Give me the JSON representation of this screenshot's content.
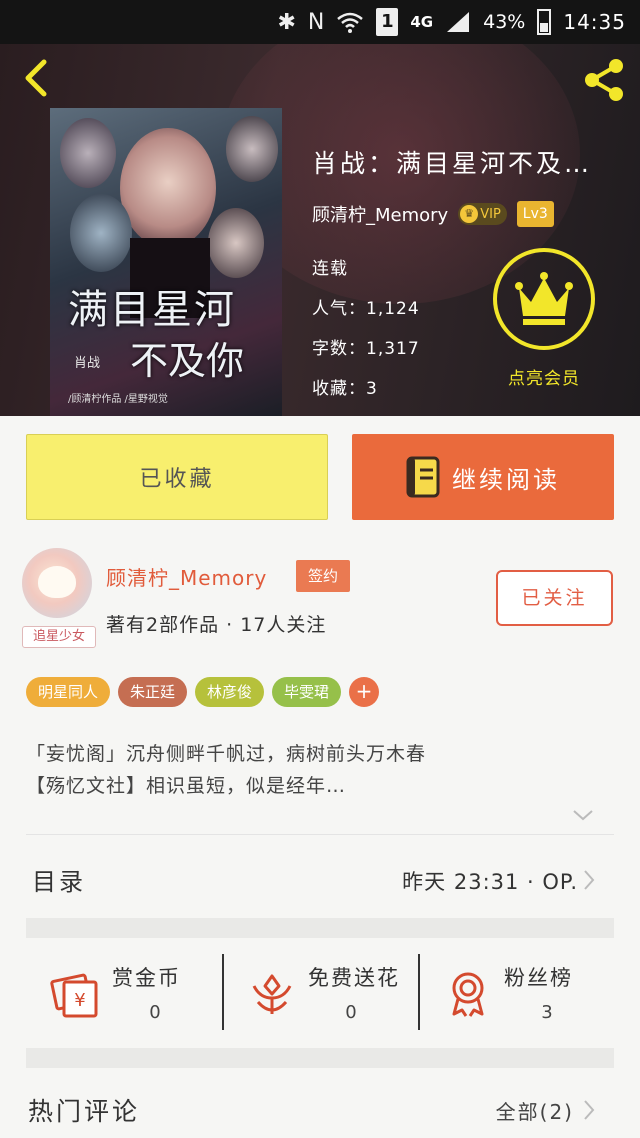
{
  "status_bar": {
    "signal_4g": "4G",
    "sim": "1",
    "battery": "43%",
    "time": "14:35"
  },
  "header": {
    "cover_text": {
      "title_line1": "满目星河",
      "title_line2": "不及你",
      "tag": "肖战",
      "credit": "/顾清柠作品 /星野视觉"
    },
    "title": "肖战：满目星河不及…",
    "author": "顾清柠_Memory",
    "vip": "VIP",
    "level": "Lv3",
    "status": "连载",
    "popularity": "人气：1,124",
    "words": "字数：1,317",
    "favorites": "收藏：3",
    "member_label": "点亮会员"
  },
  "actions": {
    "collected": "已收藏",
    "continue_reading": "继续阅读"
  },
  "author_card": {
    "name": "顾清柠_Memory",
    "signed": "签约",
    "meta": "著有2部作品 · 17人关注",
    "avatar_tag": "追星少女",
    "follow": "已关注"
  },
  "tags": [
    {
      "label": "明星同人",
      "color": "#efad3a"
    },
    {
      "label": "朱正廷",
      "color": "#c56e52"
    },
    {
      "label": "林彦俊",
      "color": "#b6c13b"
    },
    {
      "label": "毕雯珺",
      "color": "#96c04a"
    }
  ],
  "tag_add": {
    "label": "+",
    "color": "#ea7048"
  },
  "intro": {
    "line1": "「妄忧阁」沉舟侧畔千帆过，病树前头万木春",
    "line2": "【殇忆文社】相识虽短，似是经年…"
  },
  "toc": {
    "label": "目录",
    "latest": "昨天 23:31 · OP."
  },
  "stats": [
    {
      "label": "赏金币",
      "value": "0",
      "icon": "red-envelope-icon"
    },
    {
      "label": "免费送花",
      "value": "0",
      "icon": "flower-icon"
    },
    {
      "label": "粉丝榜",
      "value": "3",
      "icon": "medal-icon"
    }
  ],
  "comments": {
    "label": "热门评论",
    "all": "全部(2)"
  },
  "colors": {
    "accent": "#ea6a3c",
    "collected_bg": "#f8ef6e",
    "crown": "#f2e62a",
    "author_name": "#e15b3b"
  }
}
